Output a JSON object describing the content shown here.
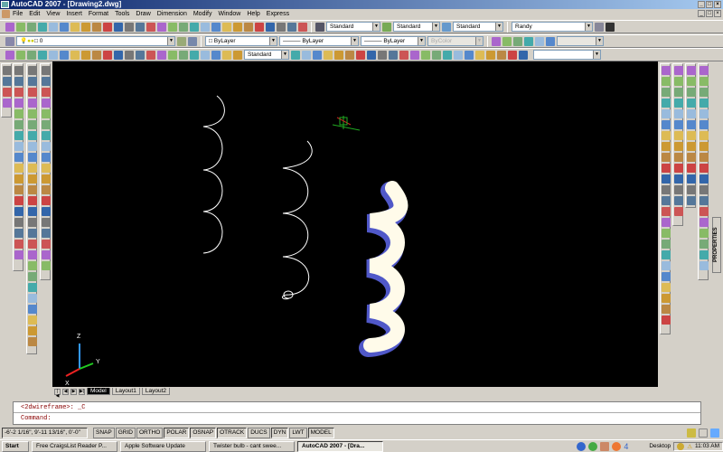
{
  "title": "AutoCAD 2007 - [Drawing2.dwg]",
  "menu": [
    "File",
    "Edit",
    "View",
    "Insert",
    "Format",
    "Tools",
    "Draw",
    "Dimension",
    "Modify",
    "Window",
    "Help",
    "Express"
  ],
  "toolbars": {
    "text_style": "Standard",
    "dim_style": "Standard",
    "table_style": "Standard",
    "workspace": "Randy",
    "layer": "0",
    "color": "ByLayer",
    "linetype": "ByLayer",
    "lineweight": "ByLayer",
    "plot_style": "ByColor",
    "dim_style2": "Standard",
    "viewport_scale": ""
  },
  "layout_tabs": [
    "Model",
    "Layout1",
    "Layout2"
  ],
  "command": {
    "line1": "<2dwireframe>: _C",
    "line2": "Command:"
  },
  "status": {
    "coords": "-6'-2 1/16\", 9'-11 13/16\", 0'-0\"",
    "buttons": [
      {
        "label": "SNAP",
        "on": false
      },
      {
        "label": "GRID",
        "on": false
      },
      {
        "label": "ORTHO",
        "on": false
      },
      {
        "label": "POLAR",
        "on": true
      },
      {
        "label": "OSNAP",
        "on": true
      },
      {
        "label": "OTRACK",
        "on": true
      },
      {
        "label": "DUCS",
        "on": false
      },
      {
        "label": "DYN",
        "on": true
      },
      {
        "label": "LWT",
        "on": false
      },
      {
        "label": "MODEL",
        "on": true
      }
    ]
  },
  "properties_tab": "PROPERTIES",
  "ucs": {
    "x": "X",
    "y": "Y",
    "z": "Z"
  },
  "taskbar": {
    "start": "Start",
    "tasks": [
      "Free CraigsList Reader P...",
      "Apple Software Update",
      "Twister bulb - cant swee...",
      "AutoCAD 2007 - [Dra..."
    ],
    "active": 3,
    "desktop": "Desktop",
    "clock": "11:03 AM",
    "quicklaunch_count": "4"
  }
}
